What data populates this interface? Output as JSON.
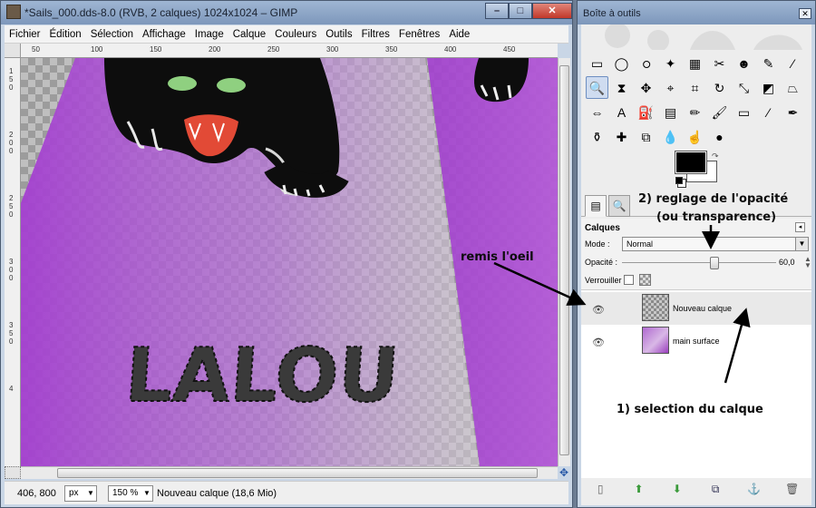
{
  "image_window": {
    "title": "*Sails_000.dds-8.0 (RVB, 2 calques) 1024x1024 – GIMP",
    "menu": [
      "Fichier",
      "Édition",
      "Sélection",
      "Affichage",
      "Image",
      "Calque",
      "Couleurs",
      "Outils",
      "Filtres",
      "Fenêtres",
      "Aide"
    ],
    "ruler_top_labels": [
      "50",
      "100",
      "150",
      "200",
      "250",
      "300",
      "350",
      "400",
      "450"
    ],
    "ruler_left_labels": [
      "1",
      "5",
      "0",
      "2",
      "0",
      "0",
      "2",
      "5",
      "0",
      "3",
      "0",
      "0",
      "3",
      "5",
      "0",
      "4"
    ],
    "canvas_text": "LALOU",
    "status": {
      "coords": "406, 800",
      "unit": "px",
      "zoom": "150 %",
      "message": "Nouveau calque (18,6 Mio)"
    }
  },
  "toolbox": {
    "title": "Boîte à outils",
    "tools": [
      {
        "name": "rect-select-icon",
        "glyph": "▭"
      },
      {
        "name": "ellipse-select-icon",
        "glyph": "◯"
      },
      {
        "name": "lasso-icon",
        "glyph": "ഠ"
      },
      {
        "name": "fuzzy-select-icon",
        "glyph": "✦"
      },
      {
        "name": "color-select-icon",
        "glyph": "▦"
      },
      {
        "name": "scissors-icon",
        "glyph": "✂"
      },
      {
        "name": "foreground-select-icon",
        "glyph": "☻"
      },
      {
        "name": "paths-icon",
        "glyph": "✎"
      },
      {
        "name": "color-picker-icon",
        "glyph": "⁄"
      },
      {
        "name": "zoom-icon",
        "glyph": "🔍"
      },
      {
        "name": "measure-icon",
        "glyph": "⧗"
      },
      {
        "name": "move-icon",
        "glyph": "✥"
      },
      {
        "name": "align-icon",
        "glyph": "⌖"
      },
      {
        "name": "crop-icon",
        "glyph": "⌗"
      },
      {
        "name": "rotate-icon",
        "glyph": "↻"
      },
      {
        "name": "scale-icon",
        "glyph": "⤡"
      },
      {
        "name": "shear-icon",
        "glyph": "◩"
      },
      {
        "name": "perspective-icon",
        "glyph": "⏢"
      },
      {
        "name": "flip-icon",
        "glyph": "⇔"
      },
      {
        "name": "text-icon",
        "glyph": "A"
      },
      {
        "name": "bucket-fill-icon",
        "glyph": "⛽"
      },
      {
        "name": "blend-icon",
        "glyph": "▤"
      },
      {
        "name": "pencil-icon",
        "glyph": "✏"
      },
      {
        "name": "paintbrush-icon",
        "glyph": "🖌"
      },
      {
        "name": "eraser-icon",
        "glyph": "▭"
      },
      {
        "name": "airbrush-icon",
        "glyph": "⁄"
      },
      {
        "name": "ink-icon",
        "glyph": "✒"
      },
      {
        "name": "clone-icon",
        "glyph": "⚱"
      },
      {
        "name": "heal-icon",
        "glyph": "✚"
      },
      {
        "name": "perspective-clone-icon",
        "glyph": "⧉"
      },
      {
        "name": "blur-icon",
        "glyph": "💧"
      },
      {
        "name": "smudge-icon",
        "glyph": "☝"
      },
      {
        "name": "dodge-burn-icon",
        "glyph": "●"
      }
    ],
    "dock_title": "Calques",
    "mode_label": "Mode :",
    "mode_value": "Normal",
    "opacity_label": "Opacité :",
    "opacity_value": "60,0",
    "opacity_fraction": 0.6,
    "lock_label": "Verrouiller :",
    "layers": [
      {
        "name": "Nouveau calque",
        "visible": true,
        "selected": true
      },
      {
        "name": "main surface",
        "visible": true,
        "selected": false
      }
    ]
  },
  "annotations": {
    "eye_note": "remis l'oeil",
    "opacity_note_line1": "2) reglage de l'opacité",
    "opacity_note_line2": "(ou transparence)",
    "selection_note": "1) selection du calque"
  },
  "colors": {
    "canvas_purple": "#a84fd1",
    "panel_bg": "#ededed",
    "title_bar": "#8ea6c6"
  }
}
